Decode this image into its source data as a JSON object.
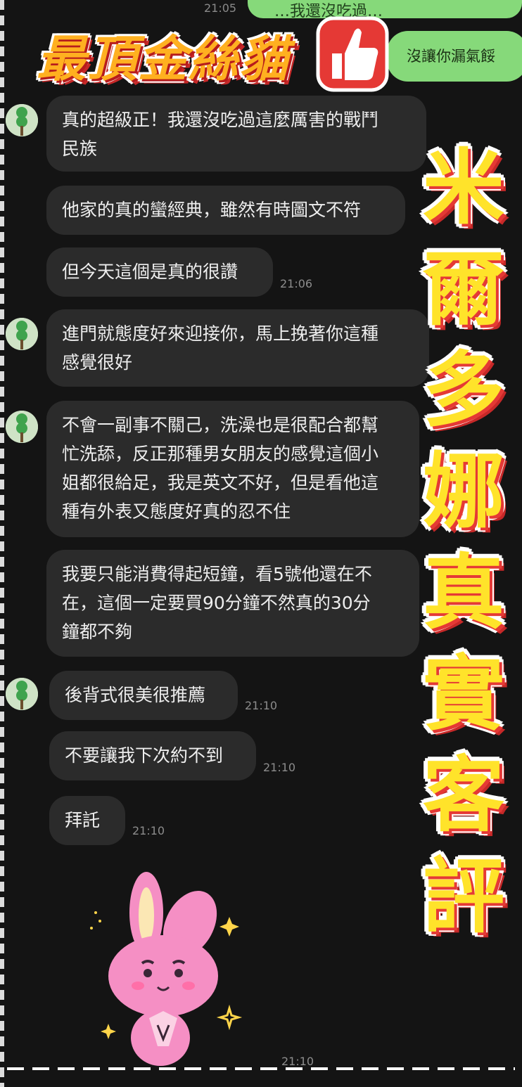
{
  "header": {
    "top_time": "21:05",
    "top_green_text": "…我還沒吃過…",
    "title": "最頂金絲貓",
    "right_green_text": "沒讓你漏氣餒"
  },
  "messages": [
    {
      "text": "真的超級正！我還沒吃過這麼厲害的戰鬥\n民族",
      "time": ""
    },
    {
      "text": "他家的真的蠻經典，雖然有時圖文不符",
      "time": ""
    },
    {
      "text": "但今天這個是真的很讚",
      "time": "21:06"
    },
    {
      "text": "進門就態度好來迎接你，馬上挽著你這種\n感覺很好",
      "time": ""
    },
    {
      "text": "不會一副事不關己，洗澡也是很配合都幫\n忙洗舔，反正那種男女朋友的感覺這個小\n姐都很給足，我是英文不好，但是看他這\n種有外表又態度好真的忍不住",
      "time": ""
    },
    {
      "text": "我要只能消費得起短鐘，看5號他還在不\n在，這個一定要買90分鐘不然真的30分\n鐘都不夠",
      "time": ""
    },
    {
      "text": "後背式很美很推薦",
      "time": "21:10"
    },
    {
      "text": "不要讓我下次約不到",
      "time": "21:10"
    },
    {
      "text": "拜託",
      "time": "21:10"
    }
  ],
  "sticker_time": "21:10",
  "overlay_chars": [
    "米",
    "爾",
    "多",
    "娜",
    "真",
    "實",
    "客",
    "評"
  ],
  "colors": {
    "bubble_incoming": "#2b2b2b",
    "bubble_outgoing": "#86d97a",
    "overlay_fill": "#ffe32a",
    "overlay_shadow": "#e53935",
    "title_fill": "#ffb020"
  },
  "icons": {
    "avatar": "green-dango-icon",
    "thumb": "thumbs-up-icon",
    "sticker": "pink-bunny-sticker"
  }
}
